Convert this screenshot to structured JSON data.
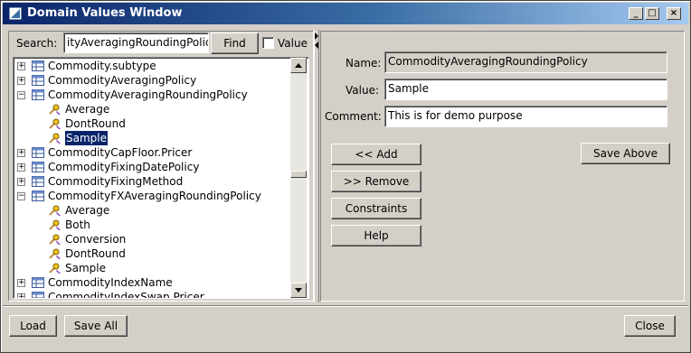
{
  "window": {
    "title": "Domain Values Window",
    "controls": {
      "minimize": "_",
      "maximize": "□",
      "close": "×"
    }
  },
  "search": {
    "label": "Search:",
    "value": "ityAveragingRoundingPolicy",
    "find_label": "Find",
    "value_checkbox_label": "Value"
  },
  "tree": {
    "items": [
      {
        "label": "Commodity.subtype",
        "type": "node",
        "expanded": false
      },
      {
        "label": "CommodityAveragingPolicy",
        "type": "node",
        "expanded": false
      },
      {
        "label": "CommodityAveragingRoundingPolicy",
        "type": "node",
        "expanded": true
      },
      {
        "label": "Average",
        "type": "leaf"
      },
      {
        "label": "DontRound",
        "type": "leaf"
      },
      {
        "label": "Sample",
        "type": "leaf",
        "selected": true
      },
      {
        "label": "CommodityCapFloor.Pricer",
        "type": "node",
        "expanded": false
      },
      {
        "label": "CommodityFixingDatePolicy",
        "type": "node",
        "expanded": false
      },
      {
        "label": "CommodityFixingMethod",
        "type": "node",
        "expanded": false
      },
      {
        "label": "CommodityFXAveragingRoundingPolicy",
        "type": "node",
        "expanded": true
      },
      {
        "label": "Average",
        "type": "leaf"
      },
      {
        "label": "Both",
        "type": "leaf"
      },
      {
        "label": "Conversion",
        "type": "leaf"
      },
      {
        "label": "DontRound",
        "type": "leaf"
      },
      {
        "label": "Sample",
        "type": "leaf"
      },
      {
        "label": "CommodityIndexName",
        "type": "node",
        "expanded": false
      },
      {
        "label": "CommodityIndexSwap.Pricer",
        "type": "node",
        "expanded": false
      }
    ]
  },
  "detail": {
    "name_label": "Name:",
    "name_value": "CommodityAveragingRoundingPolicy",
    "value_label": "Value:",
    "value_value": "Sample",
    "comment_label": "Comment:",
    "comment_value": "This is for demo purpose"
  },
  "actions": {
    "add": "<< Add",
    "remove": ">> Remove",
    "constraints": "Constraints",
    "help": "Help",
    "save_above": "Save Above"
  },
  "footer": {
    "load": "Load",
    "save_all": "Save All",
    "close": "Close"
  },
  "colors": {
    "titlebar_start": "#0a246a",
    "titlebar_end": "#a6caf0",
    "face": "#d4d0c8",
    "selection": "#0a246a"
  }
}
